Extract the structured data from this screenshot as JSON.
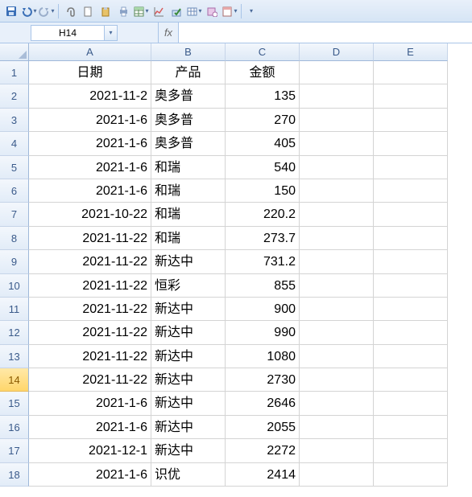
{
  "toolbar": {
    "save": "save-icon",
    "undo": "undo-icon",
    "redo": "redo-icon",
    "attach": "attach-icon",
    "new": "new-icon",
    "paste": "paste-icon",
    "print": "print-icon",
    "table": "table-icon",
    "chart": "chart-icon",
    "check": "check-icon",
    "grid": "grid-icon",
    "options": "options-icon",
    "sheet": "sheet-icon"
  },
  "namebox": {
    "value": "H14"
  },
  "fx": {
    "label": "fx",
    "value": ""
  },
  "columns": [
    "A",
    "B",
    "C",
    "D",
    "E"
  ],
  "active_row": 14,
  "headers": {
    "A": "日期",
    "B": "产品",
    "C": "金额"
  },
  "rows": [
    {
      "n": 1,
      "A": "日期",
      "B": "产品",
      "C": "金额",
      "Aal": "c",
      "Bal": "c",
      "Cal": "c"
    },
    {
      "n": 2,
      "A": "2021-11-2",
      "B": "奥多普",
      "C": "135",
      "Aal": "r",
      "Bal": "l",
      "Cal": "r"
    },
    {
      "n": 3,
      "A": "2021-1-6",
      "B": "奥多普",
      "C": "270",
      "Aal": "r",
      "Bal": "l",
      "Cal": "r"
    },
    {
      "n": 4,
      "A": "2021-1-6",
      "B": "奥多普",
      "C": "405",
      "Aal": "r",
      "Bal": "l",
      "Cal": "r"
    },
    {
      "n": 5,
      "A": "2021-1-6",
      "B": "和瑞",
      "C": "540",
      "Aal": "r",
      "Bal": "l",
      "Cal": "r"
    },
    {
      "n": 6,
      "A": "2021-1-6",
      "B": "和瑞",
      "C": "150",
      "Aal": "r",
      "Bal": "l",
      "Cal": "r"
    },
    {
      "n": 7,
      "A": "2021-10-22",
      "B": "和瑞",
      "C": "220.2",
      "Aal": "r",
      "Bal": "l",
      "Cal": "r"
    },
    {
      "n": 8,
      "A": "2021-11-22",
      "B": "和瑞",
      "C": "273.7",
      "Aal": "r",
      "Bal": "l",
      "Cal": "r"
    },
    {
      "n": 9,
      "A": "2021-11-22",
      "B": "新达中",
      "C": "731.2",
      "Aal": "r",
      "Bal": "l",
      "Cal": "r"
    },
    {
      "n": 10,
      "A": "2021-11-22",
      "B": "恒彩",
      "C": "855",
      "Aal": "r",
      "Bal": "l",
      "Cal": "r"
    },
    {
      "n": 11,
      "A": "2021-11-22",
      "B": "新达中",
      "C": "900",
      "Aal": "r",
      "Bal": "l",
      "Cal": "r"
    },
    {
      "n": 12,
      "A": "2021-11-22",
      "B": "新达中",
      "C": "990",
      "Aal": "r",
      "Bal": "l",
      "Cal": "r"
    },
    {
      "n": 13,
      "A": "2021-11-22",
      "B": "新达中",
      "C": "1080",
      "Aal": "r",
      "Bal": "l",
      "Cal": "r"
    },
    {
      "n": 14,
      "A": "2021-11-22",
      "B": "新达中",
      "C": "2730",
      "Aal": "r",
      "Bal": "l",
      "Cal": "r"
    },
    {
      "n": 15,
      "A": "2021-1-6",
      "B": "新达中",
      "C": "2646",
      "Aal": "r",
      "Bal": "l",
      "Cal": "r"
    },
    {
      "n": 16,
      "A": "2021-1-6",
      "B": "新达中",
      "C": "2055",
      "Aal": "r",
      "Bal": "l",
      "Cal": "r"
    },
    {
      "n": 17,
      "A": "2021-12-1",
      "B": "新达中",
      "C": "2272",
      "Aal": "r",
      "Bal": "l",
      "Cal": "r"
    },
    {
      "n": 18,
      "A": "2021-1-6",
      "B": "识优",
      "C": "2414",
      "Aal": "r",
      "Bal": "l",
      "Cal": "r"
    }
  ]
}
